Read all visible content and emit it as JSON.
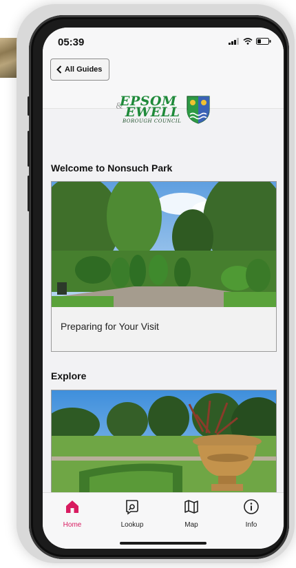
{
  "status": {
    "time": "05:39"
  },
  "nav": {
    "back_label": "All Guides"
  },
  "logo": {
    "line1": "EPSOM",
    "amp": "&",
    "line2": "EWELL",
    "line3": "BOROUGH COUNCIL"
  },
  "sections": {
    "welcome_title": "Welcome to Nonsuch Park",
    "welcome_card_caption": "Preparing for Your Visit",
    "explore_title": "Explore"
  },
  "tabbar": {
    "items": [
      {
        "label": "Home",
        "icon": "home-icon",
        "active": true
      },
      {
        "label": "Lookup",
        "icon": "lookup-icon",
        "active": false
      },
      {
        "label": "Map",
        "icon": "map-icon",
        "active": false
      },
      {
        "label": "Info",
        "icon": "info-icon",
        "active": false
      }
    ]
  },
  "colors": {
    "accent": "#d81b60",
    "brand_green": "#1f8a3a"
  }
}
